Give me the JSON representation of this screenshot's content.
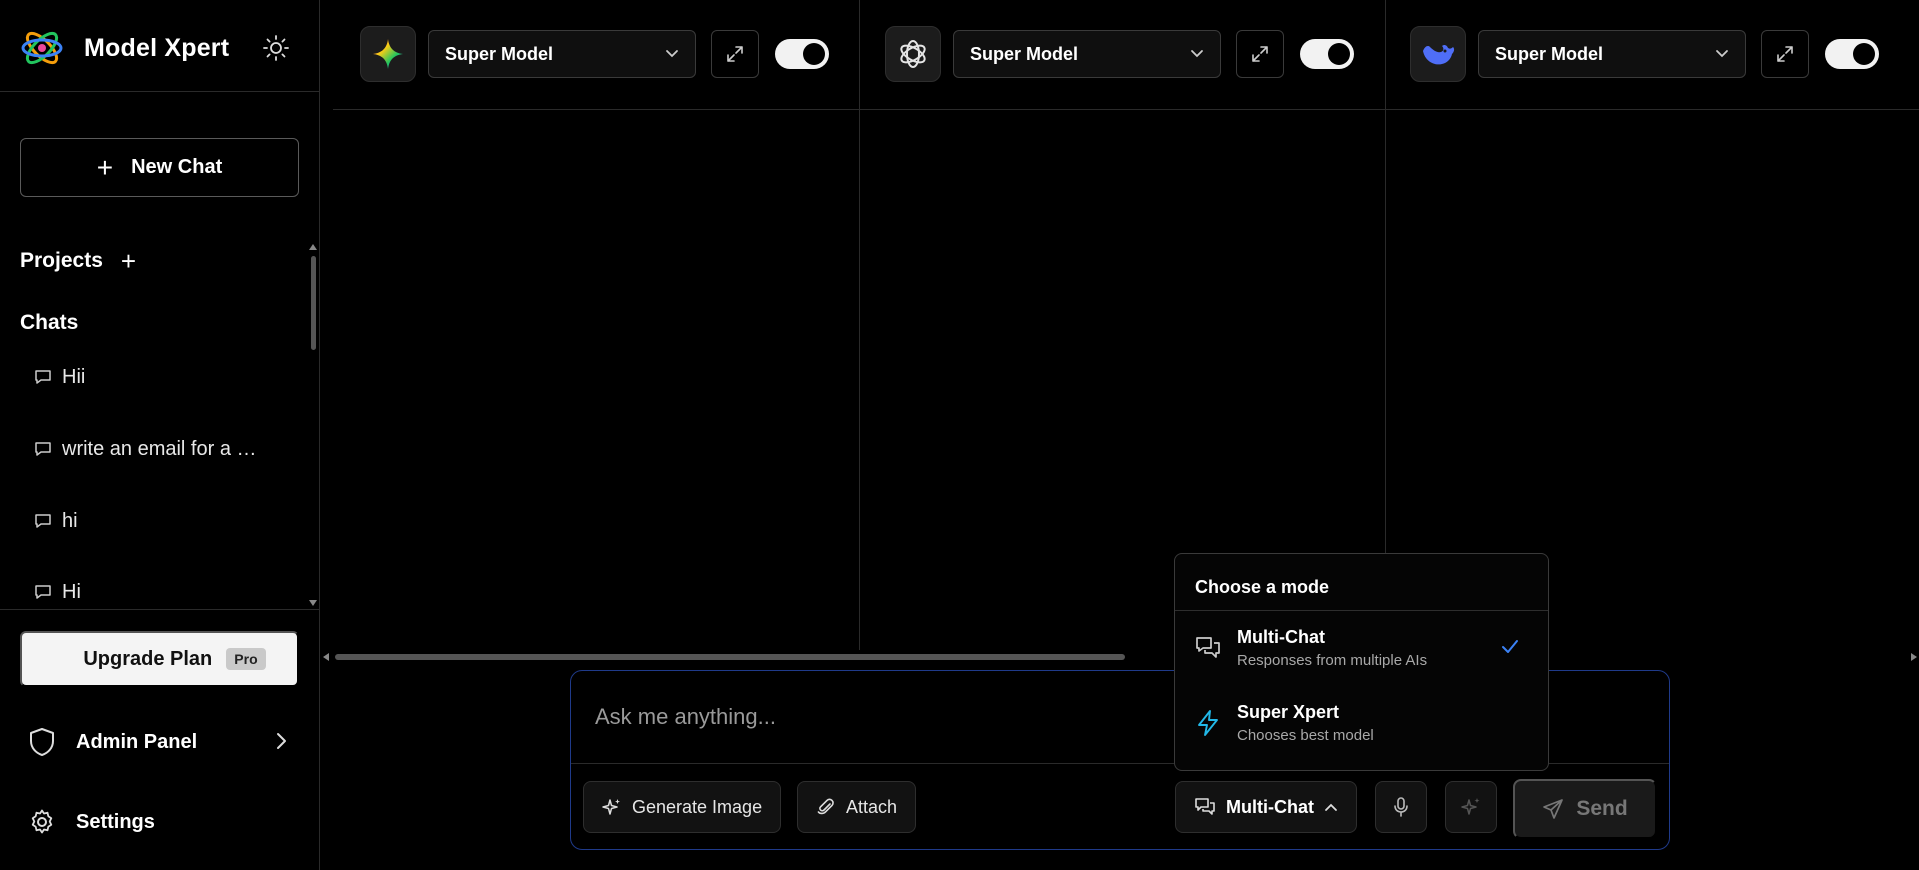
{
  "app": {
    "name": "Model Xpert"
  },
  "sidebar": {
    "new_chat_label": "New Chat",
    "projects_label": "Projects",
    "chats_label": "Chats",
    "chats": [
      {
        "label": "Hii"
      },
      {
        "label": "write an email for a …"
      },
      {
        "label": "hi"
      },
      {
        "label": "Hi"
      }
    ],
    "upgrade_label": "Upgrade Plan",
    "upgrade_badge": "Pro",
    "admin_label": "Admin Panel",
    "settings_label": "Settings"
  },
  "panels": [
    {
      "model_icon": "gemini-icon",
      "model_name": "Super Model",
      "enabled": true
    },
    {
      "model_icon": "openai-icon",
      "model_name": "Super Model",
      "enabled": true
    },
    {
      "model_icon": "deepseek-icon",
      "model_name": "Super Model",
      "enabled": true
    }
  ],
  "composer": {
    "placeholder": "Ask me anything...",
    "generate_image_label": "Generate Image",
    "attach_label": "Attach",
    "mode_label": "Multi-Chat",
    "send_label": "Send"
  },
  "mode_menu": {
    "title": "Choose a mode",
    "options": [
      {
        "name": "Multi-Chat",
        "description": "Responses from multiple AIs",
        "selected": true,
        "icon": "chat-bubbles-icon"
      },
      {
        "name": "Super Xpert",
        "description": "Chooses best model",
        "selected": false,
        "icon": "lightning-icon"
      }
    ]
  },
  "colors": {
    "background": "#000000",
    "border": "#2a2a2a",
    "composer_border": "#1f3a8a",
    "accent_blue": "#3b82f6",
    "lightning_cyan": "#22b8e8"
  }
}
